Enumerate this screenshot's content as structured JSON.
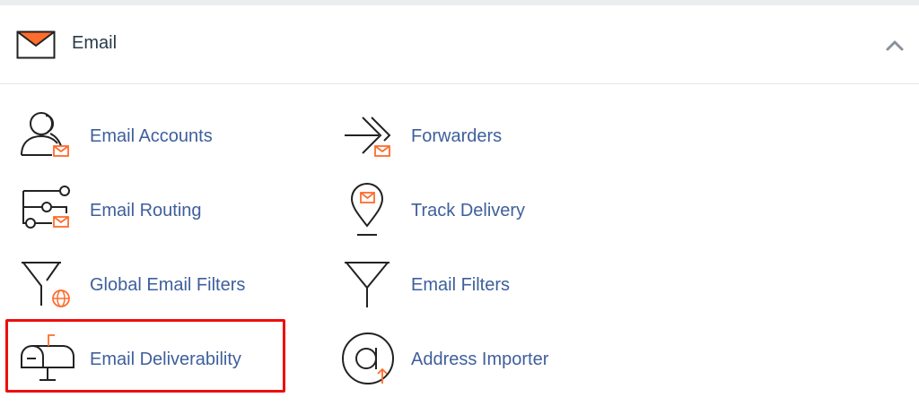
{
  "section": {
    "title": "Email",
    "icon": "envelope-icon",
    "collapse_icon": "chevron-up-icon"
  },
  "items": [
    {
      "label": "Email Accounts",
      "icon": "user-mail-icon"
    },
    {
      "label": "Forwarders",
      "icon": "forward-arrow-icon"
    },
    {
      "label": "Email Routing",
      "icon": "routing-icon"
    },
    {
      "label": "Track Delivery",
      "icon": "location-pin-icon"
    },
    {
      "label": "Global Email Filters",
      "icon": "globe-filter-icon"
    },
    {
      "label": "Email Filters",
      "icon": "filter-icon"
    },
    {
      "label": "Email Deliverability",
      "icon": "mailbox-icon"
    },
    {
      "label": "Address Importer",
      "icon": "at-sign-icon"
    }
  ],
  "colors": {
    "accent": "#ff6c2c",
    "link": "#3e5f9c",
    "icon_stroke": "#222222",
    "highlight": "#ee0d0d"
  }
}
